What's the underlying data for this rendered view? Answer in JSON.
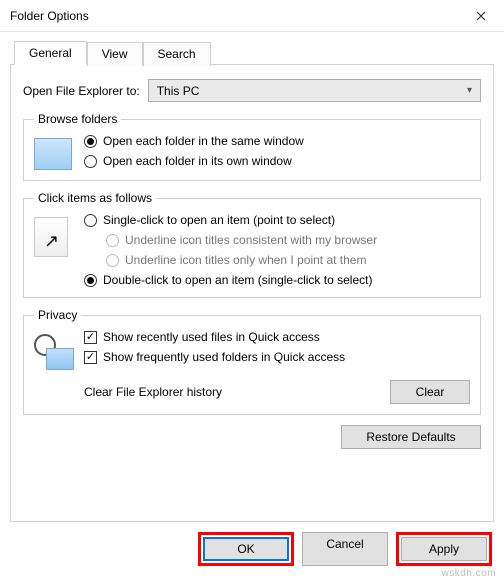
{
  "window": {
    "title": "Folder Options"
  },
  "tabs": {
    "general": "General",
    "view": "View",
    "search": "Search"
  },
  "open_to": {
    "label": "Open File Explorer to:",
    "value": "This PC"
  },
  "browse": {
    "legend": "Browse folders",
    "same": "Open each folder in the same window",
    "own": "Open each folder in its own window"
  },
  "click": {
    "legend": "Click items as follows",
    "single": "Single-click to open an item (point to select)",
    "underline_browser": "Underline icon titles consistent with my browser",
    "underline_point": "Underline icon titles only when I point at them",
    "double": "Double-click to open an item (single-click to select)"
  },
  "privacy": {
    "legend": "Privacy",
    "recent_files": "Show recently used files in Quick access",
    "frequent_folders": "Show frequently used folders in Quick access",
    "clear_label": "Clear File Explorer history",
    "clear_btn": "Clear"
  },
  "restore": "Restore Defaults",
  "footer": {
    "ok": "OK",
    "cancel": "Cancel",
    "apply": "Apply"
  },
  "watermark": "wskdh.com"
}
